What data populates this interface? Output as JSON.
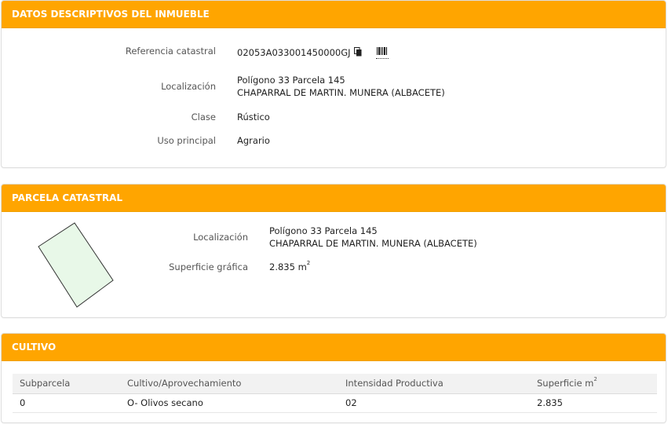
{
  "descriptivos": {
    "title": "DATOS DESCRIPTIVOS DEL INMUEBLE",
    "ref_label": "Referencia catastral",
    "ref_value": "02053A033001450000GJ",
    "loc_label": "Localización",
    "loc_line1": "Polígono 33 Parcela 145",
    "loc_line2": "CHAPARRAL DE MARTIN. MUNERA (ALBACETE)",
    "clase_label": "Clase",
    "clase_value": "Rústico",
    "uso_label": "Uso principal",
    "uso_value": "Agrario"
  },
  "parcela": {
    "title": "PARCELA CATASTRAL",
    "loc_label": "Localización",
    "loc_line1": "Polígono 33 Parcela 145",
    "loc_line2": "CHAPARRAL DE MARTIN. MUNERA (ALBACETE)",
    "sup_label": "Superficie gráfica",
    "sup_value": "2.835 m",
    "sup_exp": "2"
  },
  "cultivo": {
    "title": "CULTIVO",
    "columns": [
      "Subparcela",
      "Cultivo/Aprovechamiento",
      "Intensidad Productiva",
      "Superficie m"
    ],
    "col4_exp": "2",
    "rows": [
      [
        "0",
        "O- Olivos secano",
        "02",
        "2.835"
      ]
    ]
  },
  "colors": {
    "header": "#ffa500",
    "parcel_fill": "#e8f8e8"
  },
  "icons": [
    "copy-icon",
    "barcode-icon"
  ]
}
